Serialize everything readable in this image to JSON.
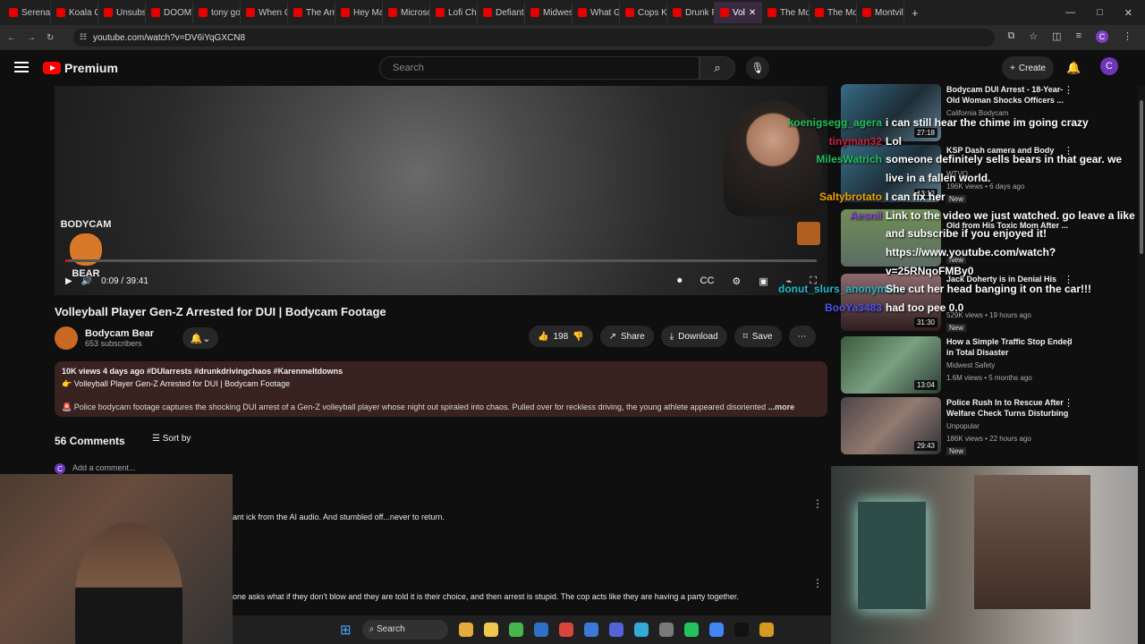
{
  "browser": {
    "tabs": [
      {
        "label": "Serena"
      },
      {
        "label": "Koala G"
      },
      {
        "label": "Unsubs"
      },
      {
        "label": "DOOM"
      },
      {
        "label": "tony go"
      },
      {
        "label": "When C"
      },
      {
        "label": "The Arr"
      },
      {
        "label": "Hey Ma"
      },
      {
        "label": "Microso"
      },
      {
        "label": "Lofi Chi"
      },
      {
        "label": "Defiant"
      },
      {
        "label": "Midwes"
      },
      {
        "label": "What G"
      },
      {
        "label": "Cops Ki"
      },
      {
        "label": "Drunk F"
      },
      {
        "label": "Vol"
      },
      {
        "label": "The Mo"
      },
      {
        "label": "The Mo"
      },
      {
        "label": "Montvil"
      }
    ],
    "address": "youtube.com/watch?v=DV6iYqGXCN8"
  },
  "youtube": {
    "brand": "Premium",
    "search_placeholder": "Search",
    "create": "Create",
    "user_initial": "C",
    "video": {
      "time": "0:09 / 39:41",
      "progress_fraction": 0.004,
      "overlay_logo": "BODYCAM",
      "overlay_logo_bottom": "BEAR",
      "title": "Volleyball Player Gen-Z Arrested for DUI | Bodycam Footage",
      "channel": "Bodycam Bear",
      "subscribers": "653 subscribers",
      "likes": "198",
      "share": "Share",
      "download": "Download",
      "save": "Save",
      "desc_meta": "10K views  4 days ago  #DUIarrests #drunkdrivingchaos #Karenmeltdowns",
      "desc_line2": "👉 Volleyball Player Gen-Z Arrested for DUI | Bodycam Footage",
      "desc_line3": "🚨 Police bodycam footage captures the shocking DUI arrest of a Gen-Z volleyball player whose night out spiraled into chaos. Pulled over for reckless driving, the young athlete appeared disoriented",
      "more": "...more"
    },
    "comments": {
      "count": "56 Comments",
      "sort": "Sort by",
      "add": "Add a comment...",
      "items": [
        {
          "text": "ant ick from the AI audio. And stumbled off...never to return."
        },
        {
          "text": "one asks what if they don't blow and they are told it is their choice, and then arrest is stupid.  The cop acts like they are having a party together."
        }
      ]
    },
    "recommended": [
      {
        "title": "Bodycam DUI Arrest - 18-Year-Old Woman Shocks Officers ...",
        "channel": "California Bodycam",
        "meta": "",
        "duration": "27:18"
      },
      {
        "title": "KSP Dash camera and Body",
        "channel": "WTVQ",
        "meta": "196K views • 6 days ago",
        "badge": "New",
        "duration": "13:12"
      },
      {
        "title": "Old from His Toxic Mom After ...",
        "channel": "",
        "meta": "",
        "badge": "New",
        "duration": ""
      },
      {
        "title": "Jack Doherty is in Denial His",
        "channel": "",
        "meta": "529K views • 19 hours ago",
        "badge": "New",
        "duration": "31:30"
      },
      {
        "title": "How a Simple Traffic Stop Ended in Total Disaster",
        "channel": "Midwest Safety",
        "meta": "1.6M views • 5 months ago",
        "badge": "",
        "duration": "13:04"
      },
      {
        "title": "Police Rush In to Rescue After Welfare Check Turns Disturbing",
        "channel": "Unpopular",
        "meta": "186K views • 22 hours ago",
        "badge": "New",
        "duration": "29:43"
      }
    ]
  },
  "chat": [
    {
      "name": "koenigsegg_agera",
      "message": "i can still hear the chime im going crazy",
      "color": "#21c05a"
    },
    {
      "name": "tinyman32",
      "message": "Lol",
      "color": "#cf2144"
    },
    {
      "name": "MilesWatrich",
      "message": "someone definitely sells bears in that gear. we live in a fallen world.",
      "color": "#21c05a"
    },
    {
      "name": "Saltybrotato",
      "message": "I can fix her",
      "color": "#f0a300"
    },
    {
      "name": "Aesnil",
      "message": "Link to the video we just watched. go leave a like and subscribe if you enjoyed it! https://www.youtube.com/watch?v=25RNqoFMBy0",
      "color": "#8f46d2"
    },
    {
      "name": "donut_slurs_anonymous",
      "message": "She cut her head banging it on the car!!!",
      "color": "#24b9c6"
    },
    {
      "name": "BooYa3483",
      "message": "had too pee 0.0",
      "color": "#4f54f0"
    }
  ],
  "taskbar": {
    "search": "Search"
  }
}
